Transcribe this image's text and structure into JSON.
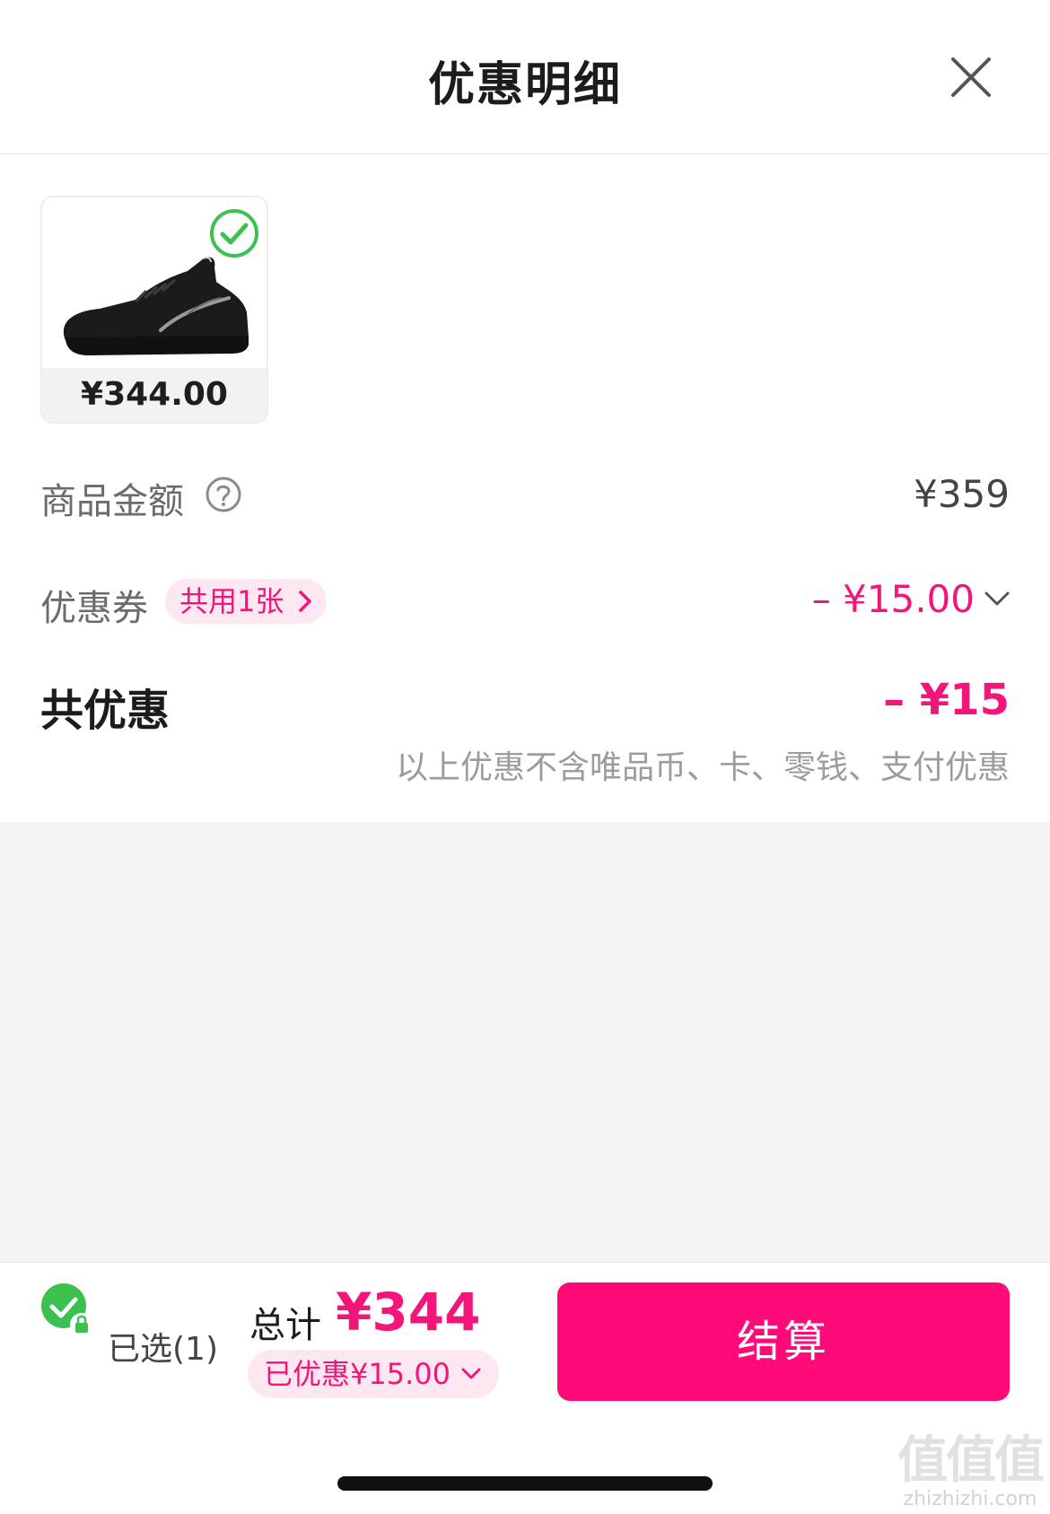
{
  "header": {
    "title": "优惠明细"
  },
  "product": {
    "price": "¥344.00"
  },
  "rows": {
    "goods_amount": {
      "label": "商品金额",
      "value": "¥359"
    },
    "coupon": {
      "label": "优惠券",
      "pill": "共用1张",
      "value": "– ¥15.00"
    },
    "total_discount": {
      "label": "共优惠",
      "value": "– ¥15"
    }
  },
  "note": "以上优惠不含唯品币、卡、零钱、支付优惠",
  "footer": {
    "selected": "已选(1)",
    "total_label": "总计",
    "total_amount": "¥344",
    "discount_pill": "已优惠¥15.00",
    "checkout": "结算"
  },
  "watermark": {
    "logo": "值值值",
    "url": "zhizhizhi.com"
  },
  "colors": {
    "accent": "#ff0a78",
    "accent_text": "#f2157a",
    "check_green": "#3cc04f"
  },
  "icons": [
    "close-icon",
    "check-circle-icon",
    "question-circle-icon",
    "chevron-right-icon",
    "chevron-down-icon",
    "lock-icon"
  ]
}
